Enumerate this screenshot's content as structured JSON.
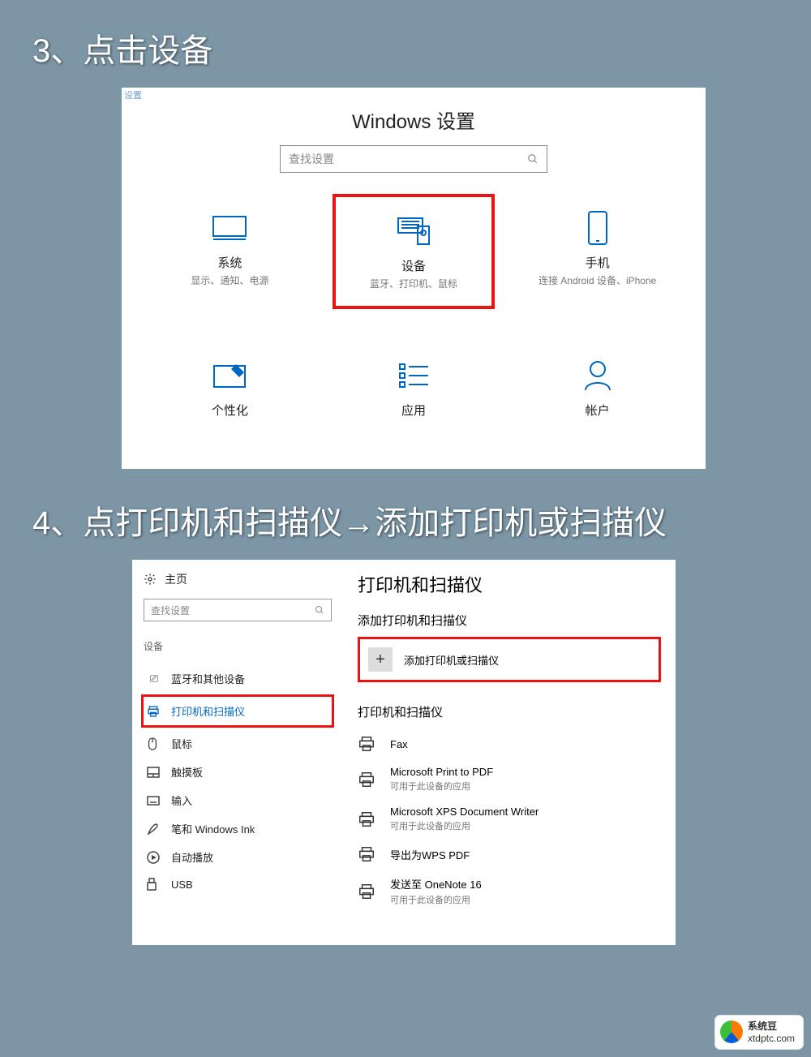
{
  "step3": {
    "heading": "3、点击设备"
  },
  "panel1": {
    "corner": "设置",
    "title": "Windows 设置",
    "search_placeholder": "查找设置",
    "tiles_row1": [
      {
        "title": "系统",
        "sub": "显示、通知、电源"
      },
      {
        "title": "设备",
        "sub": "蓝牙、打印机、鼠标"
      },
      {
        "title": "手机",
        "sub": "连接 Android 设备、iPhone"
      }
    ],
    "tiles_row2": [
      {
        "title": "个性化"
      },
      {
        "title": "应用"
      },
      {
        "title": "帐户"
      }
    ]
  },
  "step4": {
    "heading": "4、点打印机和扫描仪→添加打印机或扫描仪"
  },
  "panel2": {
    "home": "主页",
    "search_placeholder": "查找设置",
    "category": "设备",
    "side_items": [
      "蓝牙和其他设备",
      "打印机和扫描仪",
      "鼠标",
      "触摸板",
      "输入",
      "笔和 Windows Ink",
      "自动播放",
      "USB"
    ],
    "main_title": "打印机和扫描仪",
    "add_section": "添加打印机和扫描仪",
    "add_button": "添加打印机或扫描仪",
    "list_section": "打印机和扫描仪",
    "printers": [
      {
        "name": "Fax",
        "sub": ""
      },
      {
        "name": "Microsoft Print to PDF",
        "sub": "可用于此设备的应用"
      },
      {
        "name": "Microsoft XPS Document Writer",
        "sub": "可用于此设备的应用"
      },
      {
        "name": "导出为WPS PDF",
        "sub": ""
      },
      {
        "name": "发送至 OneNote 16",
        "sub": "可用于此设备的应用"
      }
    ]
  },
  "watermark": {
    "line1": "系统豆",
    "line2": "xtdptc.com"
  }
}
